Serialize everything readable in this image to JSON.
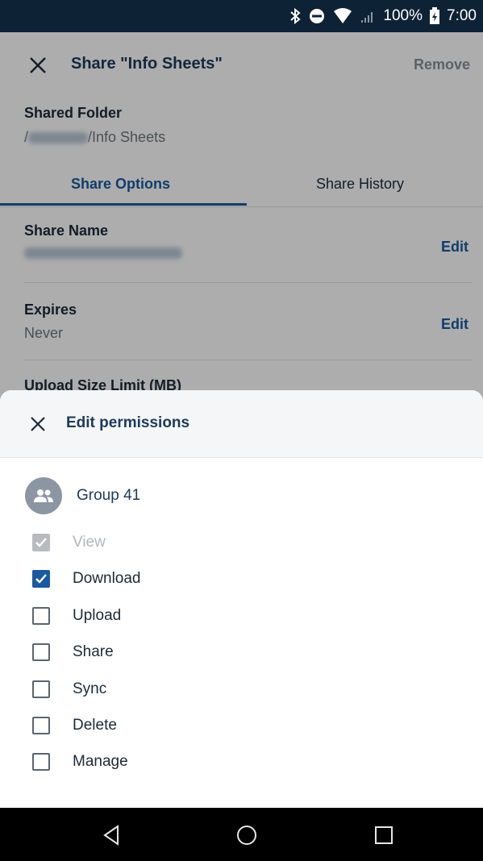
{
  "status_bar": {
    "battery": "100%",
    "time": "7:00",
    "icons": [
      "bluetooth-icon",
      "do-not-disturb-icon",
      "wifi-icon",
      "signal-icon",
      "battery-charging-icon"
    ]
  },
  "header": {
    "title": "Share \"Info Sheets\"",
    "remove_label": "Remove"
  },
  "shared_folder": {
    "label": "Shared Folder",
    "path_prefix": "/",
    "path_suffix": "/Info Sheets"
  },
  "tabs": [
    {
      "label": "Share Options",
      "active": true
    },
    {
      "label": "Share History",
      "active": false
    }
  ],
  "settings": [
    {
      "label": "Share Name",
      "value": "",
      "action": "Edit"
    },
    {
      "label": "Expires",
      "value": "Never",
      "action": "Edit"
    },
    {
      "label": "Upload Size Limit (MB)"
    }
  ],
  "sheet": {
    "title": "Edit permissions",
    "group_name": "Group 41",
    "permissions": [
      {
        "label": "View",
        "checked": true,
        "disabled": true
      },
      {
        "label": "Download",
        "checked": true,
        "disabled": false
      },
      {
        "label": "Upload",
        "checked": false,
        "disabled": false
      },
      {
        "label": "Share",
        "checked": false,
        "disabled": false
      },
      {
        "label": "Sync",
        "checked": false,
        "disabled": false
      },
      {
        "label": "Delete",
        "checked": false,
        "disabled": false
      },
      {
        "label": "Manage",
        "checked": false,
        "disabled": false
      }
    ]
  },
  "colors": {
    "accent": "#1a5aa0",
    "status_bar": "#0e2235",
    "title_text": "#1d3a5a"
  }
}
